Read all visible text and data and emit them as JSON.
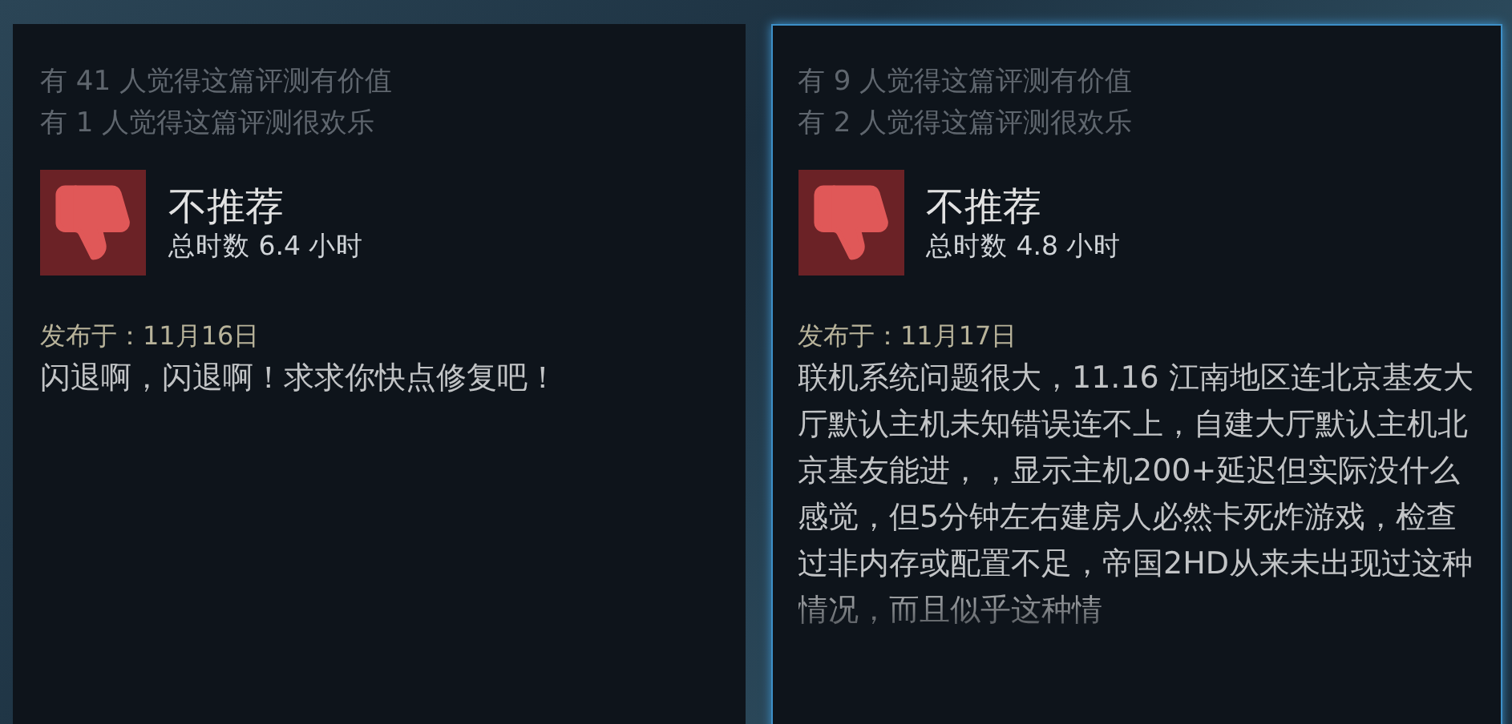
{
  "reviews": [
    {
      "selected": false,
      "helpful": "有 41 人觉得这篇评测有价值",
      "funny": "有 1 人觉得这篇评测很欢乐",
      "recommended": false,
      "verdict": "不推荐",
      "hours": "总时数 6.4 小时",
      "posted": "发布于：11月16日",
      "body": "闪退啊，闪退啊！求求你快点修复吧！"
    },
    {
      "selected": true,
      "helpful": "有 9 人觉得这篇评测有价值",
      "funny": "有 2 人觉得这篇评测很欢乐",
      "recommended": false,
      "verdict": "不推荐",
      "hours": "总时数 4.8 小时",
      "posted": "发布于：11月17日",
      "body": "联机系统问题很大，11.16 江南地区连北京基友大厅默认主机未知错误连不上，自建大厅默认主机北京基友能进，，显示主机200+延迟但实际没什么感觉，但5分钟左右建房人必然卡死炸游戏，检查过非内存或配置不足，帝国2HD从来未出现过这种情况，而且似乎这种情"
    }
  ]
}
